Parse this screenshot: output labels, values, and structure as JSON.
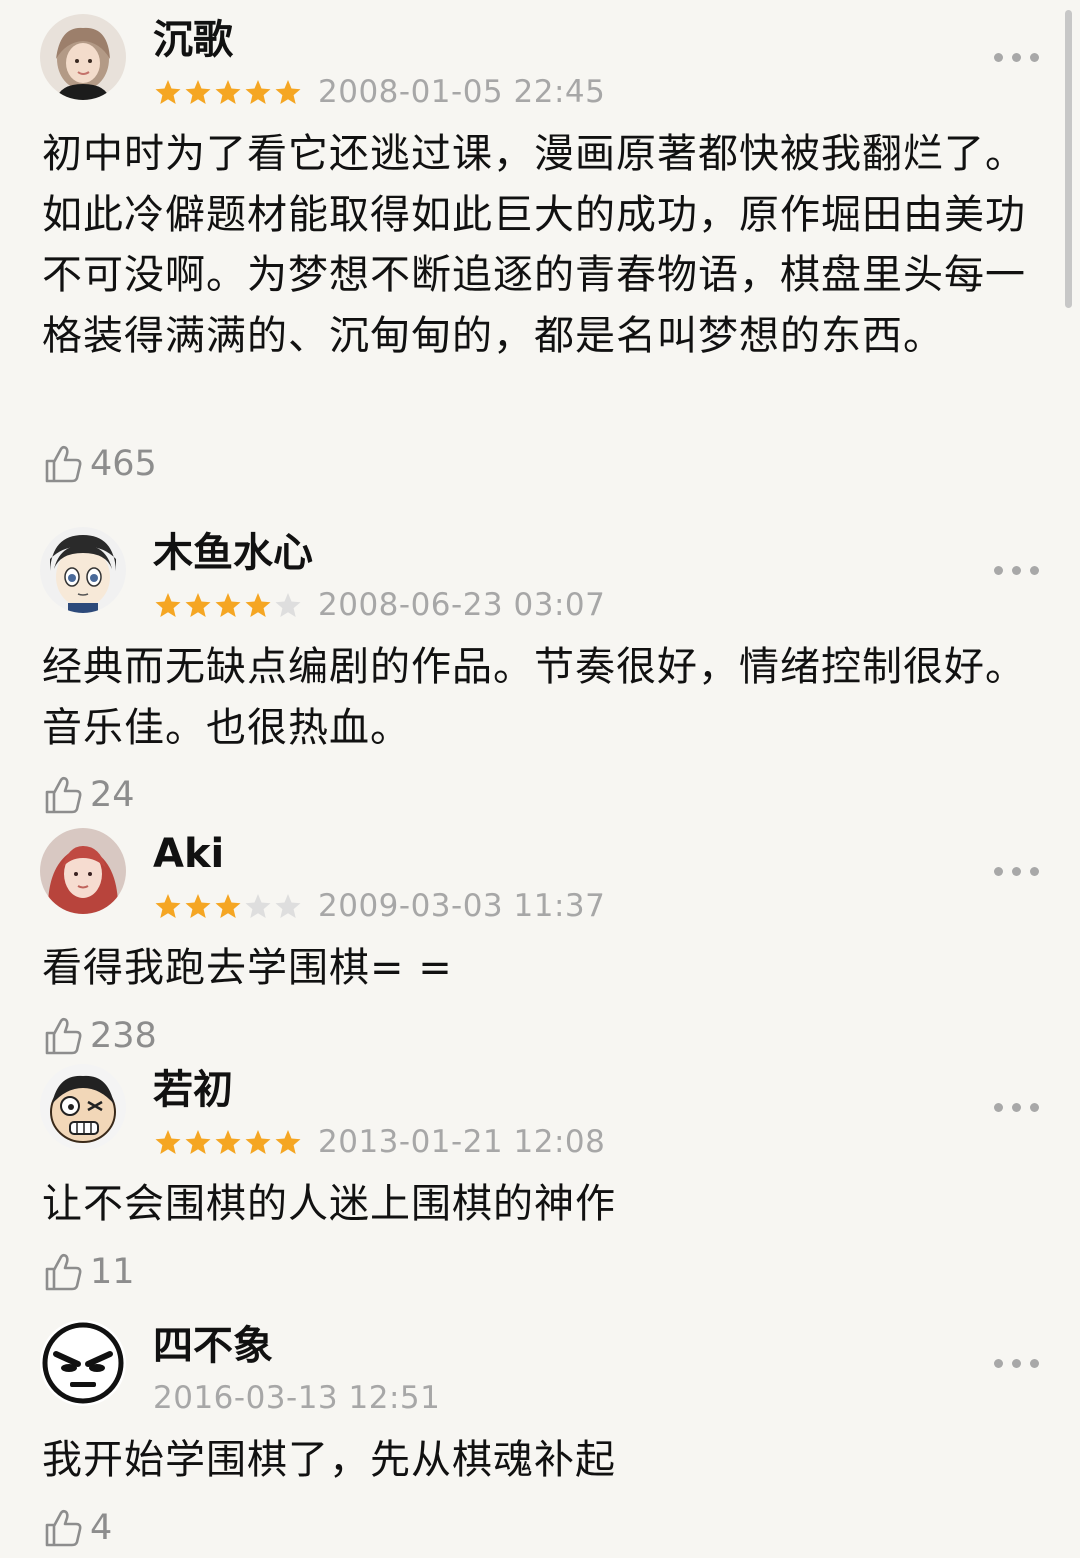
{
  "comments": [
    {
      "username": "沉歌",
      "rating": 5,
      "date": "2008-01-05 22:45",
      "text": "初中时为了看它还逃过课，漫画原著都快被我翻烂了。如此冷僻题材能取得如此巨大的成功，原作堀田由美功不可没啊。为梦想不断追逐的青春物语，棋盘里头每一格装得满满的、沉甸甸的，都是名叫梦想的东西。",
      "likes": "465"
    },
    {
      "username": "木鱼水心",
      "rating": 4,
      "date": "2008-06-23 03:07",
      "text": "经典而无缺点编剧的作品。节奏很好，情绪控制很好。音乐佳。也很热血。",
      "likes": "24"
    },
    {
      "username": "Aki",
      "rating": 3,
      "date": "2009-03-03 11:37",
      "text": "看得我跑去学围棋= =",
      "likes": "238"
    },
    {
      "username": "若初",
      "rating": 5,
      "date": "2013-01-21 12:08",
      "text": "让不会围棋的人迷上围棋的神作",
      "likes": "11"
    },
    {
      "username": "四不象",
      "rating": 0,
      "date": "2016-03-13 12:51",
      "text": "我开始学围棋了，先从棋魂补起",
      "likes": "4"
    }
  ],
  "colors": {
    "star_filled": "#f5a623",
    "star_empty": "#dedede",
    "secondary_text": "#a7a7a7",
    "background": "#f7f6f2"
  },
  "icons": {
    "like": "thumbs-up-outline-icon",
    "more": "more-dots-icon",
    "star": "star-icon"
  }
}
